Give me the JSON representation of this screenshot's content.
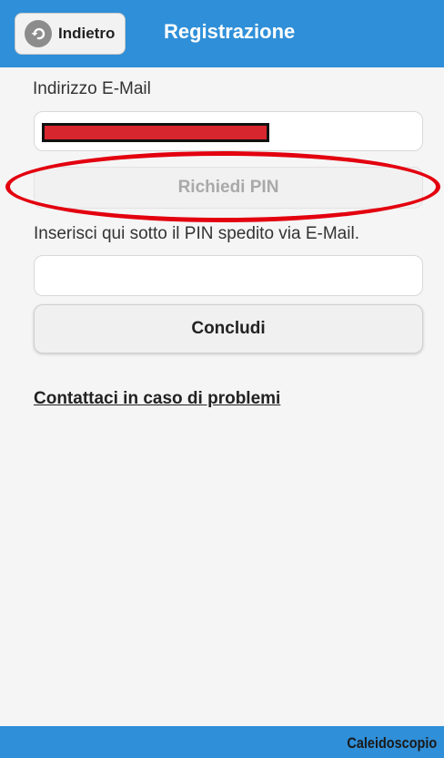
{
  "header": {
    "back_label": "Indietro",
    "title": "Registrazione"
  },
  "form": {
    "email_label": "Indirizzo E-Mail",
    "email_value": "",
    "request_pin_label": "Richiedi PIN",
    "pin_instruction": "Inserisci qui sotto il PIN spedito via E-Mail.",
    "pin_value": "",
    "submit_label": "Concludi"
  },
  "contact_link": "Contattaci in caso di problemi",
  "footer": {
    "brand": "Caleidoscopio"
  },
  "colors": {
    "bar": "#2f8fd8",
    "annotation": "#e3000f",
    "redaction": "#d8262e"
  },
  "icons": {
    "back": "back-arrow-circle-icon"
  }
}
